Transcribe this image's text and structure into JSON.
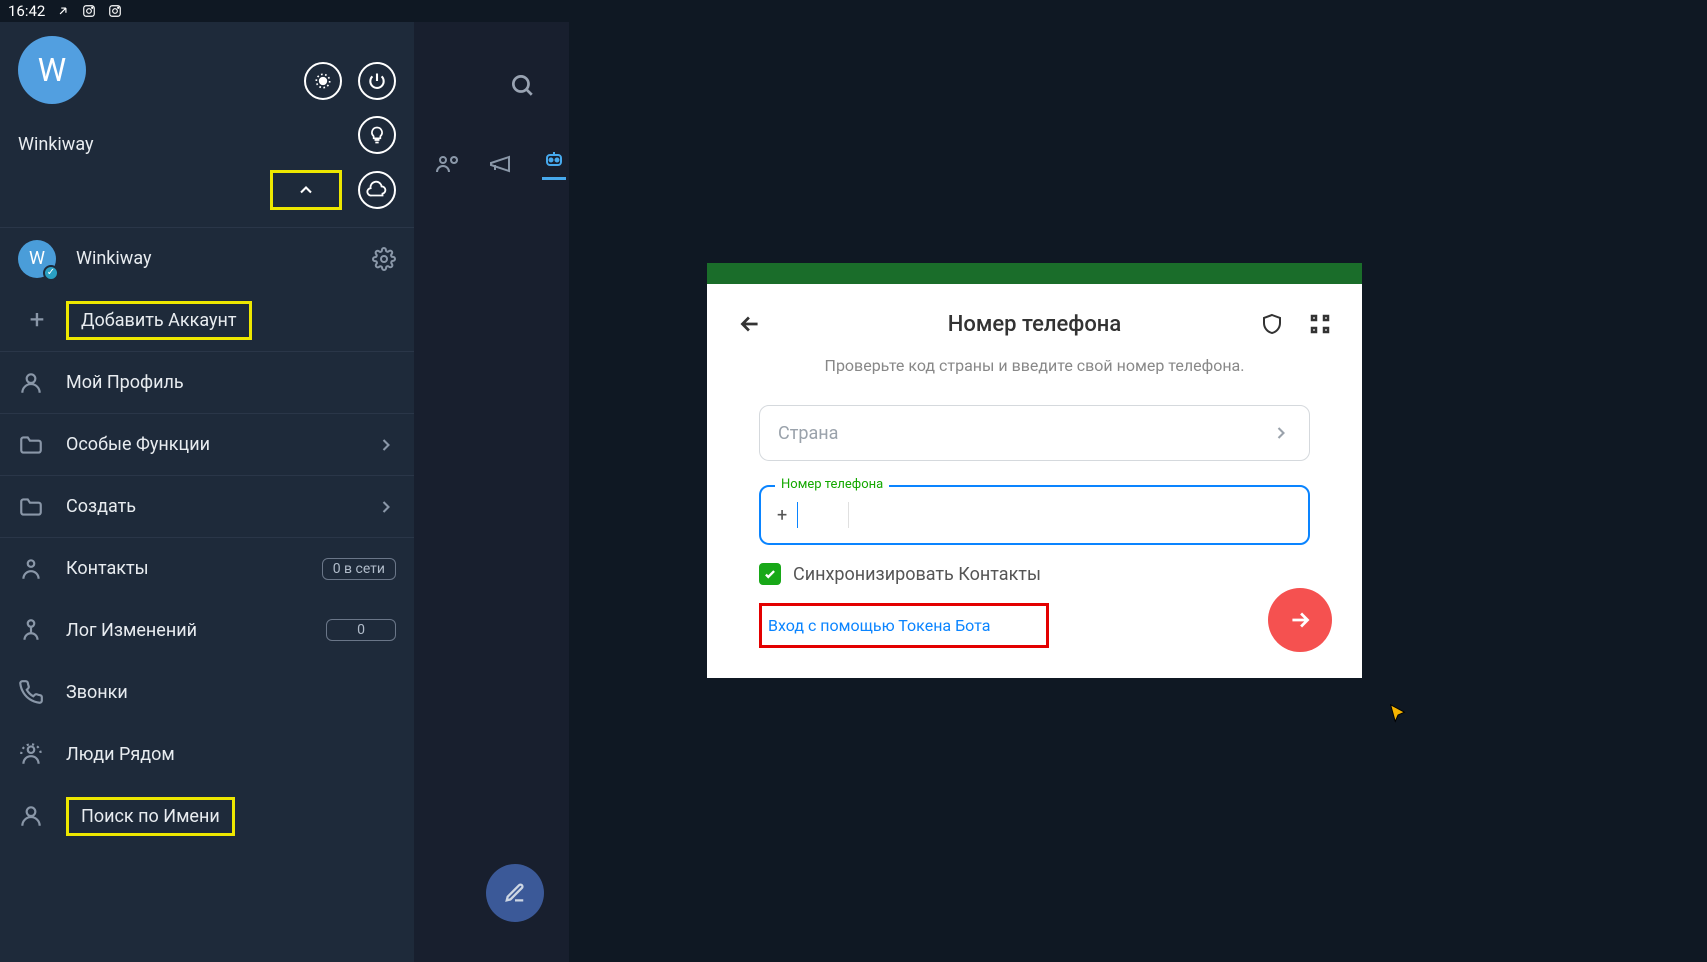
{
  "status": {
    "time": "16:42"
  },
  "header": {
    "avatar_letter": "W",
    "username": "Winkiway"
  },
  "accounts": {
    "current": {
      "letter": "W",
      "name": "Winkiway"
    },
    "add_label": "Добавить Аккаунт"
  },
  "menu": {
    "profile": "Мой Профиль",
    "special": "Особые Функции",
    "create": "Создать",
    "contacts": "Контакты",
    "contacts_badge": "0 в сети",
    "changelog": "Лог Изменений",
    "changelog_badge": "0",
    "calls": "Звонки",
    "nearby": "Люди Рядом",
    "search_name": "Поиск по Имени"
  },
  "dialog": {
    "title": "Номер телефона",
    "subtitle": "Проверьте код страны и введите свой номер телефона.",
    "country_placeholder": "Страна",
    "phone_float": "Номер телефона",
    "phone_prefix": "+",
    "sync_label": "Синхронизировать Контакты",
    "token_link": "Вход с помощью Токена Бота"
  }
}
